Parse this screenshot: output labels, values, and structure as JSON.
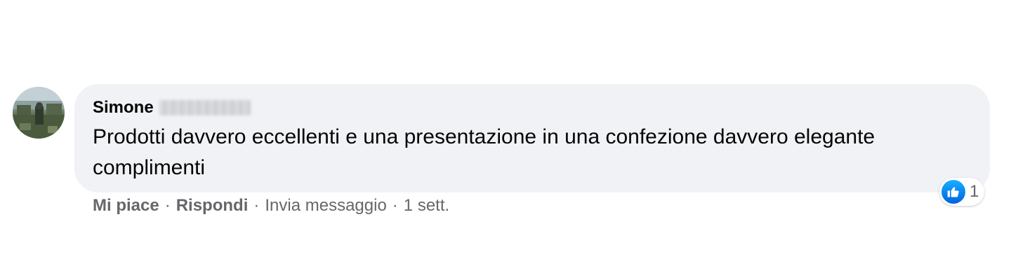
{
  "comment": {
    "author_first_name": "Simone",
    "author_surname_redacted": "Cesaroni",
    "text": "Prodotti davvero eccellenti e una presentazione in una confezione davvero elegante complimenti",
    "reactions": {
      "icon": "like-icon",
      "color": "#1877f2",
      "count": "1"
    },
    "actions": {
      "like_label": "Mi piace",
      "reply_label": "Rispondi",
      "message_label": "Invia messaggio",
      "timestamp": "1 sett.",
      "separator": "·"
    }
  },
  "colors": {
    "bubble": "#f0f2f5",
    "text": "#050505",
    "secondary_text": "#65676b"
  }
}
